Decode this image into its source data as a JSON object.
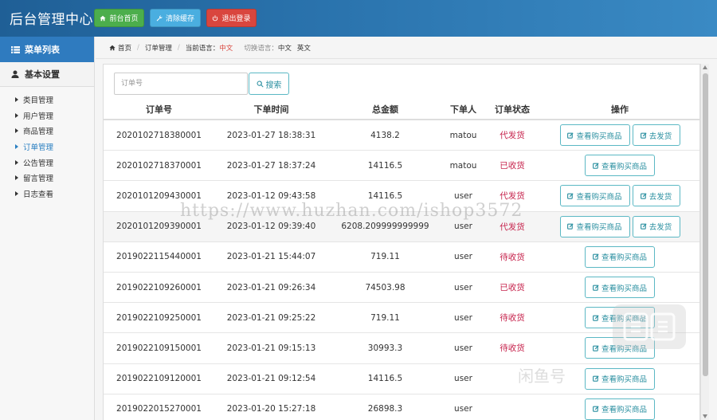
{
  "header": {
    "title": "后台管理中心",
    "buttons": [
      {
        "label": "前台首页",
        "icon": "home-icon",
        "color": "#4cae4c"
      },
      {
        "label": "清除缓存",
        "icon": "wrench-icon",
        "color": "#4aaee0"
      },
      {
        "label": "退出登录",
        "icon": "power-icon",
        "color": "#d9463e"
      }
    ]
  },
  "sidebar": {
    "menu_title": "菜单列表",
    "group_title": "基本设置",
    "items": [
      {
        "label": "类目管理"
      },
      {
        "label": "用户管理"
      },
      {
        "label": "商品管理"
      },
      {
        "label": "订单管理"
      },
      {
        "label": "公告管理"
      },
      {
        "label": "留言管理"
      },
      {
        "label": "日志查看"
      }
    ]
  },
  "breadcrumb": {
    "home": "首页",
    "section": "订单管理",
    "current_lang_label": "当前语言：",
    "current_lang_value": "中文",
    "switch_lang_label": "切换语言：",
    "lang_zh": "中文",
    "lang_en": "英文"
  },
  "search": {
    "placeholder": "订单号",
    "button_label": "搜索"
  },
  "table": {
    "headers": [
      "订单号",
      "下单时间",
      "总金额",
      "下单人",
      "订单状态",
      "操作"
    ],
    "view_label": "查看购买商品",
    "ship_label": "去发货",
    "rows": [
      {
        "order_no": "2020102718380001",
        "time": "2023-01-27 18:38:31",
        "amount": "4138.2",
        "user": "matou",
        "status": "代发货"
      },
      {
        "order_no": "2020102718370001",
        "time": "2023-01-27 18:37:24",
        "amount": "14116.5",
        "user": "matou",
        "status": "已收货"
      },
      {
        "order_no": "2020101209430001",
        "time": "2023-01-12 09:43:58",
        "amount": "14116.5",
        "user": "user",
        "status": "代发货"
      },
      {
        "order_no": "2020101209390001",
        "time": "2023-01-12 09:39:40",
        "amount": "6208.209999999999",
        "user": "user",
        "status": "代发货"
      },
      {
        "order_no": "2019022115440001",
        "time": "2023-01-21 15:44:07",
        "amount": "719.11",
        "user": "user",
        "status": "待收货"
      },
      {
        "order_no": "2019022109260001",
        "time": "2023-01-21 09:26:34",
        "amount": "74503.98",
        "user": "user",
        "status": "已收货"
      },
      {
        "order_no": "2019022109250001",
        "time": "2023-01-21 09:25:22",
        "amount": "719.11",
        "user": "user",
        "status": "待收货"
      },
      {
        "order_no": "2019022109150001",
        "time": "2023-01-21 09:15:13",
        "amount": "30993.3",
        "user": "user",
        "status": "待收货"
      },
      {
        "order_no": "2019022109120001",
        "time": "2023-01-21 09:12:54",
        "amount": "14116.5",
        "user": "user",
        "status": ""
      },
      {
        "order_no": "2019022015270001",
        "time": "2023-01-20 15:27:18",
        "amount": "26898.3",
        "user": "user",
        "status": ""
      }
    ]
  },
  "watermarks": {
    "url": "https://www.huzhan.com/ishop3572",
    "text": "闲鱼号"
  },
  "colors": {
    "accent": "#2f7bbf",
    "status_red": "#c7254e",
    "outline_teal": "#5bb8c4"
  }
}
